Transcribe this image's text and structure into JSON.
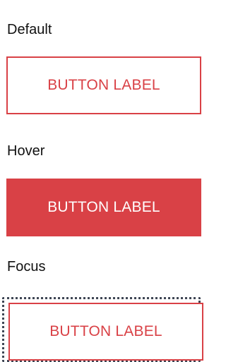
{
  "states": {
    "default": {
      "label": "Default",
      "button_label": "BUTTON LABEL"
    },
    "hover": {
      "label": "Hover",
      "button_label": "BUTTON LABEL"
    },
    "focus": {
      "label": "Focus",
      "button_label": "BUTTON LABEL"
    }
  },
  "colors": {
    "accent": "#d94146",
    "focus_ring": "#3f4654",
    "label_text": "#111111",
    "background": "#ffffff"
  }
}
